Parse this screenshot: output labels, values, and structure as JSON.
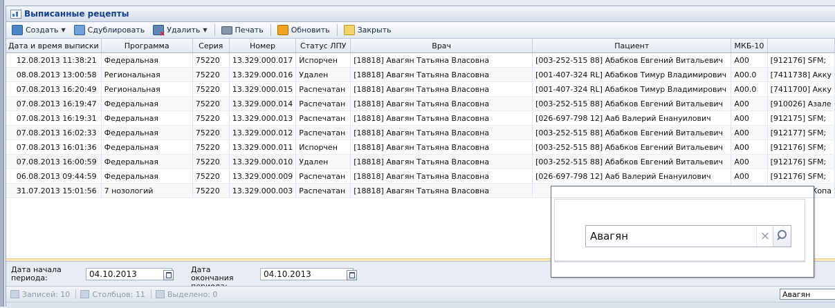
{
  "window": {
    "title": "Выписанные рецепты"
  },
  "toolbar": {
    "create": "Создать",
    "duplicate": "Сдублировать",
    "delete": "Удалить",
    "print": "Печать",
    "refresh": "Обновить",
    "close": "Закрыть"
  },
  "grid": {
    "columns": [
      "Дата и время выписки",
      "Программа",
      "Серия",
      "Номер",
      "Статус ЛПУ",
      "Врач",
      "Пациент",
      "МКБ-10",
      ""
    ],
    "rows": [
      [
        "12.08.2013 11:38:21",
        "Федеральная",
        "75220",
        "13.329.000.017",
        "Испорчен",
        "[18818] Авагян Татьяна Власовна",
        "[003-252-515 88] Абабков Евгений Витальевич",
        "A00",
        "[912176] SFM;"
      ],
      [
        "08.08.2013 13:00:58",
        "Региональная",
        "75220",
        "13.329.000.016",
        "Удален",
        "[18818] Авагян Татьяна Власовна",
        "[001-407-324 RL] Абабков Тимур Владимирович",
        "A00.0",
        "[7411738] Акку"
      ],
      [
        "07.08.2013 16:20:49",
        "Региональная",
        "75220",
        "13.329.000.015",
        "Распечатан",
        "[18818] Авагян Татьяна Власовна",
        "[001-407-324 RL] Абабков Тимур Владимирович",
        "A00.0",
        "[7411700] Акку"
      ],
      [
        "07.08.2013 16:19:47",
        "Федеральная",
        "75220",
        "13.329.000.014",
        "Распечатан",
        "[18818] Авагян Татьяна Власовна",
        "[003-252-515 88] Абабков Евгений Витальевич",
        "A00",
        "[910026] Азале"
      ],
      [
        "07.08.2013 16:19:31",
        "Федеральная",
        "75220",
        "13.329.000.013",
        "Распечатан",
        "[18818] Авагян Татьяна Власовна",
        "[026-697-798 12] Ааб Валерий Енануилович",
        "A00",
        "[912175] SFM;"
      ],
      [
        "07.08.2013 16:02:33",
        "Федеральная",
        "75220",
        "13.329.000.012",
        "Распечатан",
        "[18818] Авагян Татьяна Власовна",
        "[003-252-515 88] Абабков Евгений Витальевич",
        "A00",
        "[912177] SFM;"
      ],
      [
        "07.08.2013 16:01:36",
        "Федеральная",
        "75220",
        "13.329.000.011",
        "Испорчен",
        "[18818] Авагян Татьяна Власовна",
        "[003-252-515 88] Абабков Евгений Витальевич",
        "A00",
        "[912176] SFM;"
      ],
      [
        "07.08.2013 16:00:59",
        "Федеральная",
        "75220",
        "13.329.000.010",
        "Удален",
        "[18818] Авагян Татьяна Власовна",
        "[003-252-515 88] Абабков Евгений Витальевич",
        "A00",
        "[912176] SFM;"
      ],
      [
        "06.08.2013 09:44:59",
        "Федеральная",
        "75220",
        "13.329.000.009",
        "Распечатан",
        "[18818] Авагян Татьяна Власовна",
        "[026-697-798 12] Ааб Валерий Енануилович",
        "A00",
        "[912176] SFM;"
      ],
      [
        "31.07.2013 15:01:56",
        "7 нозологий",
        "75220",
        "13.329.000.003",
        "Распечатан",
        "[18818] Авагян Татьяна Власовна",
        "",
        "",
        "3] Копа"
      ]
    ]
  },
  "filter": {
    "start_label": "Дата начала периода:",
    "start_value": "04.10.2013",
    "end_label": "Дата окончания периода:",
    "end_value": "04.10.2013"
  },
  "status": {
    "records": "Записей: 10",
    "columns": "Столбцов: 11",
    "selected": "Выделено: 0",
    "search_value": "Авагян"
  },
  "popup": {
    "search_value": "Авагян",
    "clear_symbol": "×"
  }
}
